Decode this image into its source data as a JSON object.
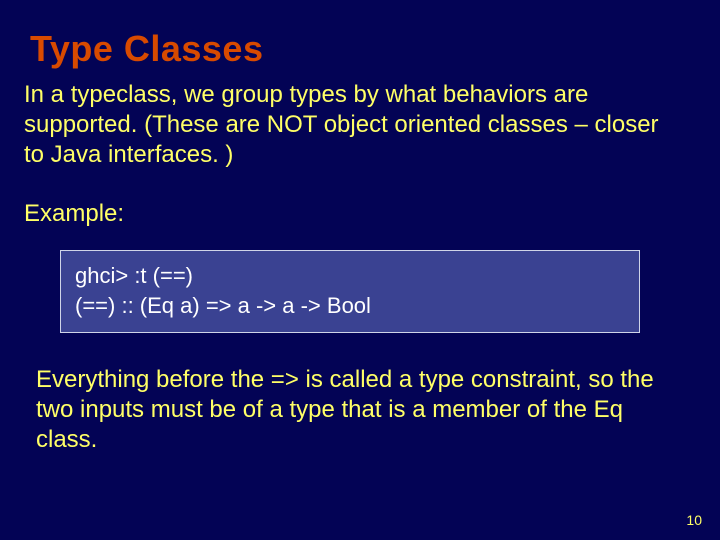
{
  "title": "Type Classes",
  "intro": "In a typeclass, we group types by what behaviors are supported.  (These are NOT object oriented classes – closer to Java interfaces. )",
  "example_label": "Example:",
  "code": {
    "line1": "ghci> :t (==)",
    "line2": "(==) :: (Eq a) => a -> a -> Bool"
  },
  "explain": "Everything before the => is called a type constraint, so the two inputs must be of a type that is a member of the Eq class.",
  "page_number": "10"
}
